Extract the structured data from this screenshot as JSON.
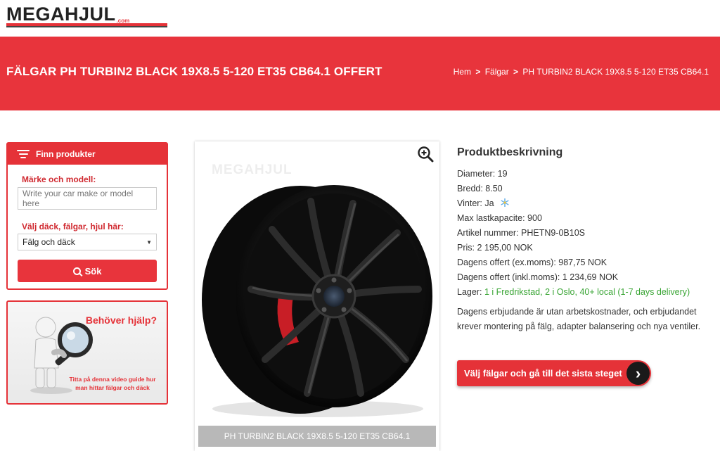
{
  "header": {
    "logo_text": "MEGAHJUL",
    "logo_suffix": ".com"
  },
  "banner": {
    "title": "FÄLGAR PH TURBIN2 BLACK 19X8.5 5-120 ET35 CB64.1 OFFERT",
    "breadcrumb": [
      "Hem",
      "Fälgar",
      "PH TURBIN2 BLACK 19X8.5 5-120 ET35 CB64.1"
    ],
    "separator": ">"
  },
  "finder": {
    "title": "Finn produkter",
    "make_label": "Märke och modell:",
    "make_placeholder": "Write your car make or model here",
    "type_label": "Välj däck, fälgar, hjul här:",
    "type_value": "Fälg och däck",
    "search_label": "Sök"
  },
  "help": {
    "title": "Behöver hjälp?",
    "subtitle": "Titta på denna video guide hur man hittar fälgar och däck"
  },
  "product": {
    "watermark": "MEGAHJUL",
    "caption": "PH TURBIN2 BLACK 19X8.5 5-120 ET35 CB64.1"
  },
  "description": {
    "title": "Produktbeskrivning",
    "diameter": "Diameter: 19",
    "width": "Bredd: 8.50",
    "winter": "Vinter: Ja",
    "max_load": "Max lastkapacite: 900",
    "article": "Artikel nummer: PHETN9-0B10S",
    "price": "Pris: 2 195,00 NOK",
    "offer_ex": "Dagens offert (ex.moms): 987,75 NOK",
    "offer_inkl": "Dagens offert (inkl.moms): 1 234,69 NOK",
    "stock_label": "Lager:",
    "stock_fredrikstad": "1 i Fredrikstad",
    "stock_oslo": "2 i Oslo",
    "stock_local": "40+ local (1-7 days delivery)",
    "stock_sep": ",",
    "text": "Dagens erbjudande är utan arbetskostnader, och erbjudandet krever montering på fälg, adapter balansering och nya ventiler.",
    "cta": "Välj fälgar och gå till det sista steget"
  },
  "colors": {
    "brand_red": "#e8343c",
    "stock_green": "#3aa535"
  },
  "icons": {
    "menu": "menu-icon",
    "search": "search-icon",
    "zoom": "zoom-in-icon",
    "snowflake": "snowflake-icon",
    "arrow": "chevron-right-icon"
  }
}
